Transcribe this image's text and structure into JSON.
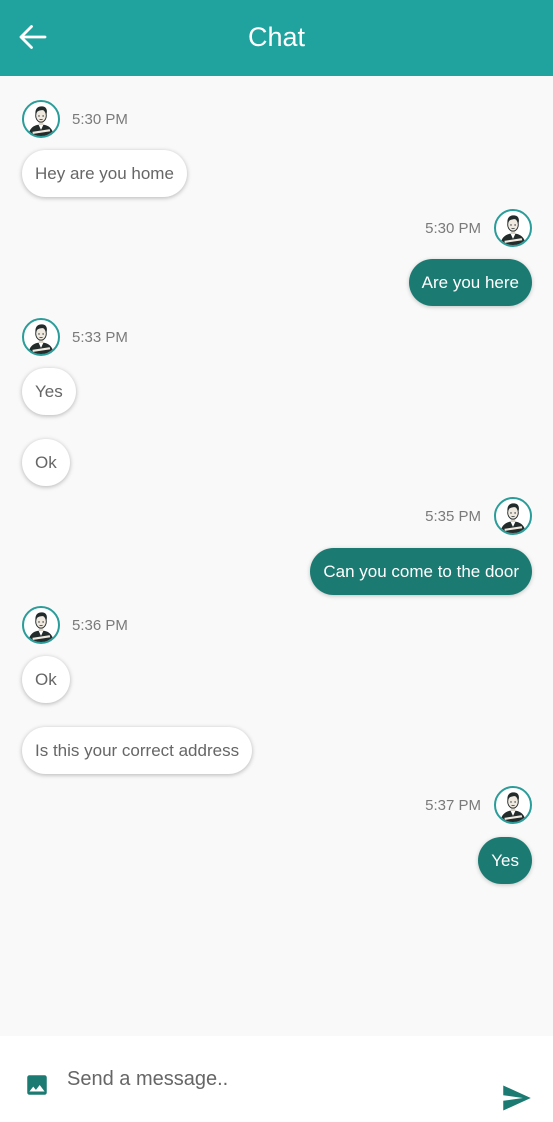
{
  "appbar": {
    "title": "Chat",
    "back_icon": "arrow-back-icon",
    "background": "#20a39e"
  },
  "colors": {
    "outgoing_bubble": "#1b7a72",
    "incoming_bubble": "#ffffff",
    "accent": "#20a39e"
  },
  "messages": [
    {
      "direction": "incoming",
      "time": "5:30 PM",
      "text": "Hey are you home"
    },
    {
      "direction": "outgoing",
      "time": "5:30 PM",
      "text": "Are you here"
    },
    {
      "direction": "incoming",
      "time": "5:33 PM",
      "text": "Yes"
    },
    {
      "direction": "incoming",
      "text": "Ok"
    },
    {
      "direction": "outgoing",
      "time": "5:35 PM",
      "text": "Can you come to the door"
    },
    {
      "direction": "incoming",
      "time": "5:36 PM",
      "text": "Ok"
    },
    {
      "direction": "incoming",
      "text": "Is this your correct address"
    },
    {
      "direction": "outgoing",
      "time": "5:37 PM",
      "text": "Yes"
    }
  ],
  "composer": {
    "placeholder": "Send a message..",
    "value": "",
    "image_icon": "image-icon",
    "send_icon": "send-icon"
  }
}
